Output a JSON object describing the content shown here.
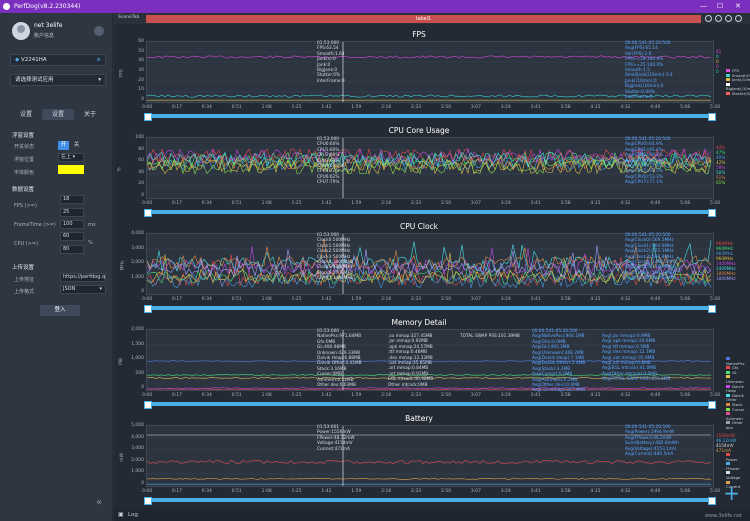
{
  "window": {
    "title": "PerfDog(v8.2.230344)",
    "controls": [
      "—",
      "☐",
      "✕"
    ]
  },
  "sidebar": {
    "user_name": "net 3elife",
    "user_info": "账户信息",
    "device": "V2241HA",
    "app_select": "请选择测试应用",
    "tabs": [
      "设置",
      "设置",
      "关于"
    ],
    "float_section": "浮窗设置",
    "float_switch_label": "开关状态",
    "float_switch_on": "开",
    "float_switch_off": "关",
    "float_pos_label": "浮窗位置",
    "float_pos_value": "左上",
    "font_color_label": "字体颜色",
    "font_color": "#ffff00",
    "data_section": "数据设置",
    "fps_label": "FPS (>=)",
    "fps_values": [
      "18",
      "25"
    ],
    "frametime_label": "FrameTime (>=)",
    "frametime_value": "100",
    "frametime_unit": "ms",
    "cpu_label": "CPU (>=)",
    "cpu_values": [
      "60",
      "80"
    ],
    "cpu_unit": "%",
    "upload_section": "上传设置",
    "upload_addr_label": "上传地址",
    "upload_addr_value": "https://perfdog.q",
    "upload_fmt_label": "上传格式",
    "upload_fmt_value": "JSON",
    "login_button": "登入",
    "collapse_icon": "«"
  },
  "header": {
    "scene_tab": "SceneTab",
    "label": "label1"
  },
  "x_ticks": [
    "0:00",
    "0:17",
    "0:34",
    "0:51",
    "1:08",
    "1:25",
    "1:42",
    "1:59",
    "2:16",
    "2:33",
    "2:50",
    "3:07",
    "3:24",
    "3:41",
    "3:58",
    "4:15",
    "4:32",
    "4:49",
    "5:06",
    "5:20"
  ],
  "charts": [
    {
      "title": "FPS",
      "ylabel": "FPS",
      "yticks": [
        "60",
        "50",
        "40",
        "30",
        "20",
        "10",
        "0"
      ],
      "info": "01:53:000\nFPS:63.54\nSmooth:1.64\nJank(s):0\nJank:0\nBigJank:0\nStutter:0%\nInterFrame:0",
      "stats": "00:00:541-05:20:500\nAvg(FPS):65.14\nVar(FPS):2.6\nFPS>=18:100.0%\nFPS>=25:100.0%\nSmooth:1.5\nSmallJank(/10min):3.4\nJank(/10min):0\nBigJank(/10min):0\nStutter:0.00%\nInterFrame:0",
      "legend": [
        "FPS",
        "Smooth(%)",
        "Jank(/10min)",
        "BigJank(/10min)",
        "Stutter(%)"
      ],
      "legend_colors": [
        "#e04ae0",
        "#3fd3c4",
        "#e0c04a",
        "#ffffff",
        "#ff6060"
      ],
      "side_values": [
        "61",
        "0",
        "0",
        "0",
        "0"
      ]
    },
    {
      "title": "CPU Core Usage",
      "ylabel": "%",
      "yticks": [
        "100",
        "80",
        "60",
        "40",
        "20",
        "0"
      ],
      "info": "01:53:000\nCPU0:60%\nCPU1:60%\nCPU2:60%\nCPU3:63%\nCPU4:60%\nCPU5:72%\nCPU6:62%\nCPU7:79%",
      "stats": "00:00:541-05:20:500\nAvg(CPU0):64.9%\nAvg(CPU1):65.4%\nAvg(CPU2):68.2%\nAvg(CPU3):62.0%\nAvg(CPU4):57.3%\nAvg(CPU5):62.5%\nAvg(CPU6):53.3%\nAvg(CPU7):77.1%",
      "side_values": [
        "44%",
        "47%",
        "49%",
        "42%",
        "59%",
        "50%",
        "51%",
        "61%"
      ]
    },
    {
      "title": "CPU Clock",
      "ylabel": "MHz",
      "yticks": [
        "4,000",
        "3,000",
        "2,000",
        "1,000",
        "0"
      ],
      "info": "01:53:000\nClock0:500MHz\nClock1:500MHz\nClock2:500MHz\nClock3:500MHz\nClock4:1400MHz\nClock5:1400MHz\nClock6:1700MHz\nClock7:1400MHz",
      "stats": "00:00:541-05:20:500\nAvg(Clock0):569.5MHz\nAvg(Clock1):564.6MHz\nAvg(Clock2):572.1MHz\nAvg(Clock3):569.8MHz\nAvg(Clock4):1400.1MHz\nAvg(Clock5):1400.8MHz\nAvg(Clock6):1691.0MHz\nAvg(Clock7):1474.8MHz",
      "side_values": [
        "960MHz",
        "960MHz",
        "960MHz",
        "960MHz",
        "1400MHz",
        "1400MHz",
        "1800MHz",
        "1800MHz"
      ]
    },
    {
      "title": "Memory Detail",
      "ylabel": "MB",
      "yticks": [
        "2,000",
        "1,500",
        "1,000",
        "500",
        "0"
      ],
      "info": "01:53:000\nNativePss:971.64MB\nGfx:0MB\nGL:490.98MB\nUnknown:429.33MB\nDalvik Heap:6.88MB\nDalvik Other:3.41MB\nStack:3.16MB\nCursor:0MB\nAshmem:0.12MB\nOther dev:0.03MB",
      "info2": ".so mmap:327.45MB\n.jar mmap:0.92MB\n.apk mmap:24.57MB\n.ttf mmap:0.46MB\n.dex mmap:12.33MB\n.oat mmap:35.85MB\n.art mmap:0.84MB\n.art mmap:0.91MB\nEGL mtrack:40.98MB\nOther mtrack:0MB",
      "total": "TOTAL SWAP PSS:101.39MB",
      "stats": "00:00:541-05:20:500\nAvg(NativePss):904.1MB\nAvg(Gfx):0.0MB\nAvg(GL):493.3MB\nAvg(Unknown):408.2MB\nAvg(Dalvik Heap):7.1MB\nAvg(Dalvik Other):3.4MB\nAvg(Stack):3.2MB\nAvg(Cursor):0.0MB\nAvg(Ashmem):0.1MB\nAvg(Other dev):0.0MB\nAvg(.so mmap):327.4MB",
      "stats2": "Avg(.jar mmap):0.9MB\nAvg(.apk mmap):24.6MB\nAvg(.ttf mmap):0.5MB\nAvg(.dex mmap):12.3MB\nAvg(.oat mmap):35.9MB\nAvg(.art mmap):0.8MB\nAvg(EGL mtrack):41.0MB\nAvg(Other mtrack):0.0MB\nAvg(TOTAL SWAP PSS):101.4MB",
      "legend": [
        "NativePss",
        "Gfx",
        "GL",
        "Unknown",
        "Dalvik Heap",
        "Dalvik Other",
        "Stack",
        "Cursor",
        "Ashmem",
        "Other dev"
      ],
      "legend_colors": [
        "#4a7ae0",
        "#e04a4a",
        "#4ae07a",
        "#e0c04a",
        "#c04ae0",
        "#4ae0e0",
        "#e08a4a",
        "#8ae04a",
        "#e04aa0",
        "#a0a0a0"
      ]
    },
    {
      "title": "Battery",
      "ylabel": "mW",
      "yticks": [
        "5,000",
        "4,000",
        "3,000",
        "2,000",
        "1,000",
        "0"
      ],
      "info": "01:53:601\nPower:1556mW\nFPower:48.12mW\nVoltage:4154mV\nCurrent:471mA",
      "stats": "00:00:541-05:20:500\nAvg(Power):1994.9mW\nAvg(FPower):46.2mW\nSum(Battery):482.6mWh\nAvg(Voltage):4153.1mV\nAvg(Current):480.5mA",
      "legend": [
        "Power",
        "FPower",
        "Voltage",
        "Current"
      ],
      "legend_colors": [
        "#e04a4a",
        "#4ab1e8",
        "#e0e0e0",
        "#e0a04a"
      ],
      "side_values": [
        "1556mW",
        "46.12mW",
        "4154mV",
        "471mA"
      ]
    }
  ],
  "bottom": {
    "log_label": "Log",
    "watermark": "www.3elife.net"
  }
}
